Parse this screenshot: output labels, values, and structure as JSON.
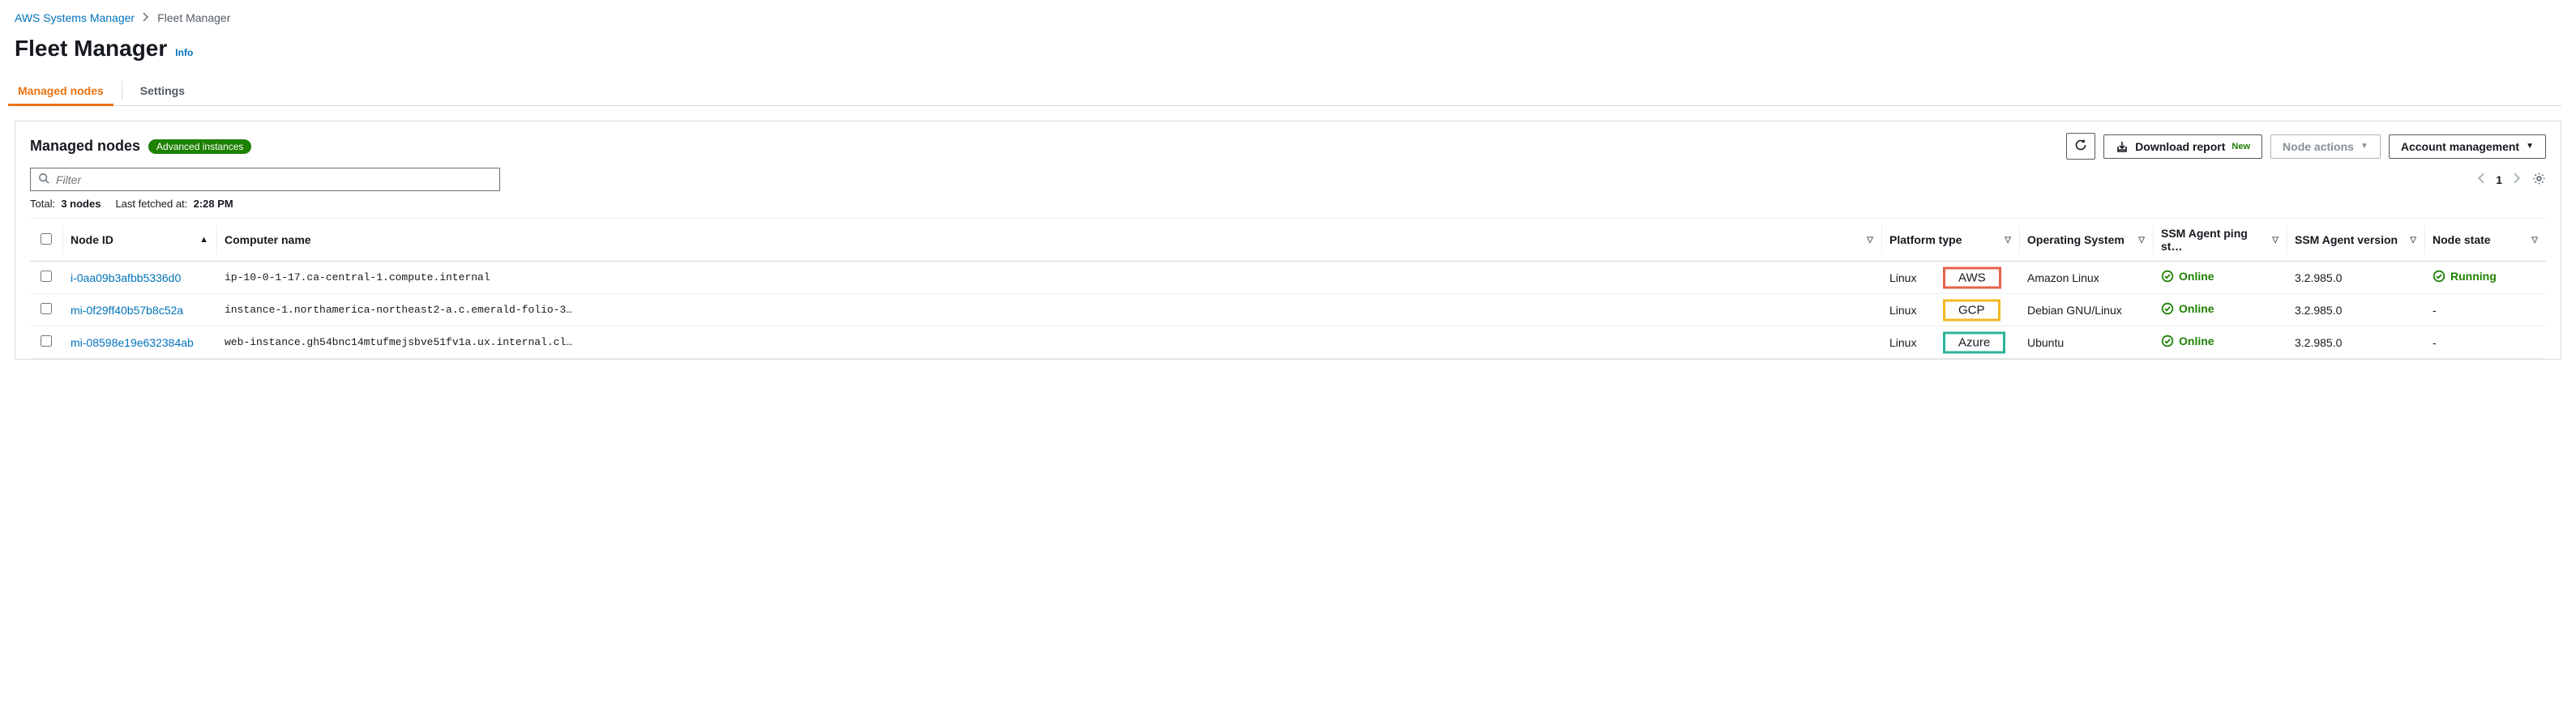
{
  "breadcrumb": {
    "service": "AWS Systems Manager",
    "current": "Fleet Manager"
  },
  "page": {
    "title": "Fleet Manager",
    "info_link": "Info"
  },
  "tabs": {
    "managed_nodes": "Managed nodes",
    "settings": "Settings"
  },
  "panel": {
    "title": "Managed nodes",
    "badge": "Advanced instances",
    "actions": {
      "download_report": "Download report",
      "download_new": "New",
      "node_actions": "Node actions",
      "account_mgmt": "Account management"
    },
    "filter_placeholder": "Filter",
    "pagination": {
      "page": "1"
    },
    "meta": {
      "total_label": "Total:",
      "total_value": "3 nodes",
      "fetched_label": "Last fetched at:",
      "fetched_value": "2:28 PM"
    }
  },
  "table": {
    "headers": {
      "node_id": "Node ID",
      "computer_name": "Computer name",
      "platform_type": "Platform type",
      "os": "Operating System",
      "ping": "SSM Agent ping st…",
      "version": "SSM Agent version",
      "state": "Node state"
    },
    "rows": [
      {
        "node_id": "i-0aa09b3afbb5336d0",
        "computer_name": "ip-10-0-1-17.ca-central-1.compute.internal",
        "platform_type": "Linux",
        "chip": "AWS",
        "chip_class": "aws",
        "os": "Amazon Linux",
        "ping": "Online",
        "version": "3.2.985.0",
        "state": "Running",
        "state_ok": true
      },
      {
        "node_id": "mi-0f29ff40b57b8c52a",
        "computer_name": "instance-1.northamerica-northeast2-a.c.emerald-folio-3…",
        "platform_type": "Linux",
        "chip": "GCP",
        "chip_class": "gcp",
        "os": "Debian GNU/Linux",
        "ping": "Online",
        "version": "3.2.985.0",
        "state": "-",
        "state_ok": false
      },
      {
        "node_id": "mi-08598e19e632384ab",
        "computer_name": "web-instance.gh54bnc14mtufmejsbve51fv1a.ux.internal.cl…",
        "platform_type": "Linux",
        "chip": "Azure",
        "chip_class": "azure",
        "os": "Ubuntu",
        "ping": "Online",
        "version": "3.2.985.0",
        "state": "-",
        "state_ok": false
      }
    ]
  }
}
